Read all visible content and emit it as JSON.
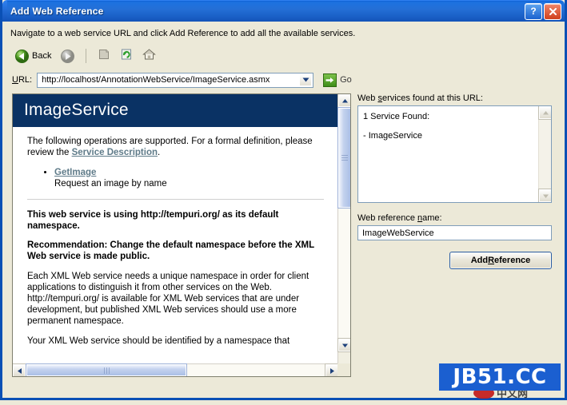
{
  "window": {
    "title": "Add Web Reference",
    "help_button": "?",
    "close_button": "✕"
  },
  "instruction": "Navigate to a web service URL and click Add Reference to add all the available services.",
  "toolbar": {
    "back_label": "Back",
    "items": [
      {
        "name": "back",
        "label": "Back",
        "icon": "back-arrow-icon",
        "enabled": true
      },
      {
        "name": "forward",
        "label": "",
        "icon": "forward-arrow-icon",
        "enabled": false
      },
      {
        "name": "stop",
        "label": "",
        "icon": "stop-icon",
        "enabled": false
      },
      {
        "name": "refresh",
        "label": "",
        "icon": "refresh-icon",
        "enabled": true
      },
      {
        "name": "home",
        "label": "",
        "icon": "home-icon",
        "enabled": true
      }
    ]
  },
  "url_bar": {
    "label": "URL:",
    "label_accel": "U",
    "label_rest": "RL:",
    "value": "http://localhost/AnnotationWebService/ImageService.asmx",
    "placeholder": "",
    "go_label": "Go",
    "dropdown_icon": "chevron-down-icon"
  },
  "browser": {
    "service_title": "ImageService",
    "intro_part1": "The following operations are supported. For a formal definition, please review the ",
    "intro_link": "Service Description",
    "intro_part2": ".",
    "operations": [
      {
        "name": "GetImage",
        "description": "Request an image by name"
      }
    ],
    "bold_1": "This web service is using http://tempuri.org/ as its default namespace.",
    "bold_2": "Recommendation: Change the default namespace before the XML Web service is made public.",
    "para_1": "Each XML Web service needs a unique namespace in order for client applications to distinguish it from other services on the Web. http://tempuri.org/ is available for XML Web services that are under development, but published XML Web services should use a more permanent namespace.",
    "para_2": "Your XML Web service should be identified by a namespace that"
  },
  "right_pane": {
    "services_label_pre": "Web ",
    "services_label_accel": "s",
    "services_label_post": "ervices found at this URL:",
    "services_found": [
      "1 Service Found:",
      "- ImageService"
    ],
    "ref_name_label_pre": "Web reference ",
    "ref_name_label_accel": "n",
    "ref_name_label_post": "ame:",
    "ref_name_value": "ImageWebService",
    "add_button_pre": "Add ",
    "add_button_accel": "R",
    "add_button_post": "eference"
  },
  "watermark": {
    "text": "JB51.CC",
    "sub_text": "中文网"
  },
  "colors": {
    "titlebar_blue": "#1d72e0",
    "dialog_face": "#ece9d8",
    "service_header": "#0a3264",
    "link": "#5f7b89",
    "watermark_blue": "#1b5fd0",
    "border_blue": "#0a50b5"
  }
}
